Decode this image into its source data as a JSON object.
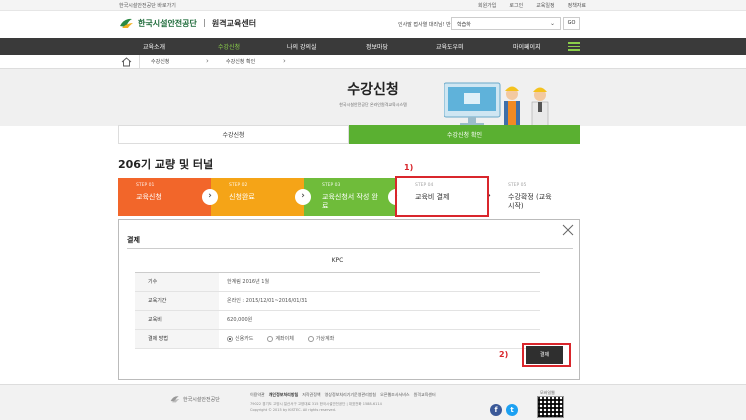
{
  "util_bar": {
    "left_link": "한국시설안전공단 바로가기",
    "right_links": [
      "회원가입",
      "로그인",
      "교육일정",
      "정책자료"
    ]
  },
  "header": {
    "logo_text": "한국시설안전공단",
    "logo_sub": "원격교육센터",
    "greeting": "인사말 접사열 대리님! 반갑습니다!",
    "select_value": "학습하",
    "go_label": "GO"
  },
  "nav": {
    "items": [
      "교육소개",
      "수강신청",
      "나의 강의실",
      "정보마당",
      "교육도우미",
      "마이페이지"
    ],
    "active_index": 1
  },
  "breadcrumb": {
    "items": [
      "수강신청",
      "수강신청 확인"
    ]
  },
  "hero": {
    "title": "수강신청",
    "subtitle": "한국시설안전공단 온라인원격교육시스템"
  },
  "tabs": [
    "수강신청",
    "수강신청 확인"
  ],
  "course_title": "206기 교량 및 터널",
  "steps": [
    {
      "no": "STEP 01",
      "label": "교육신청",
      "color": "#f2662a"
    },
    {
      "no": "STEP 02",
      "label": "신청완료",
      "color": "#f5a417"
    },
    {
      "no": "STEP 03",
      "label": "교육신청서 작성 완료",
      "color": "#6fbc3a"
    },
    {
      "no": "STEP 04",
      "label": "교육비 결제",
      "color": "#ffffff"
    },
    {
      "no": "STEP 05",
      "label": "수강확정 (교육시작)",
      "color": "#ffffff"
    }
  ],
  "annotations": {
    "label_1": "1)",
    "label_2": "2)"
  },
  "modal": {
    "title": "결제",
    "table_head": "KPC",
    "rows": [
      {
        "label": "기수",
        "value": "한계림 2016년 1월"
      },
      {
        "label": "교육기간",
        "value": "온라인 : 2015/12/01~2016/01/31"
      },
      {
        "label": "교육비",
        "value": "620,000원"
      },
      {
        "label": "결제 방법",
        "value": ""
      }
    ],
    "payment_methods": [
      "신용카드",
      "계좌이체",
      "가상계좌"
    ],
    "selected_method": 0,
    "pay_button": "결제"
  },
  "footer": {
    "logo_text": "한국시설안전공단",
    "links": [
      "이용약관",
      "개인정보처리방침",
      "저작권정책",
      "영상정보처리기기운영관리방침",
      "오픈웹조사서비스",
      "원격교육센터"
    ],
    "address": "79022 경기도 고양시 일산서구 고양대로 315 한국시설안전공단 | 대표전화 1588-6114",
    "copyright": "Copyright © 2015 by KISTEC. All rights reserved.",
    "qr_label": "모바일웹"
  }
}
